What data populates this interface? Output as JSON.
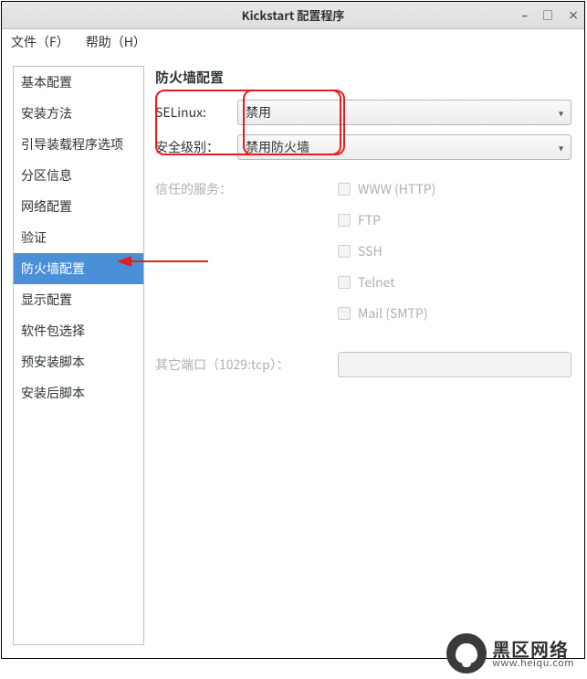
{
  "titlebar": {
    "title": "Kickstart 配置程序"
  },
  "menubar": {
    "file": "文件（F）",
    "help": "帮助（H）"
  },
  "sidebar": {
    "items": [
      "基本配置",
      "安装方法",
      "引导装载程序选项",
      "分区信息",
      "网络配置",
      "验证",
      "防火墙配置",
      "显示配置",
      "软件包选择",
      "预安装脚本",
      "安装后脚本"
    ],
    "selected_index": 6
  },
  "panel": {
    "title": "防火墙配置",
    "selinux_label": "SELinux:",
    "selinux_value": "禁用",
    "seclevel_label": "安全级别：",
    "seclevel_value": "禁用防火墙",
    "trusted_label": "信任的服务：",
    "services": [
      "WWW (HTTP)",
      "FTP",
      "SSH",
      "Telnet",
      "Mail (SMTP)"
    ],
    "other_ports_label": "其它端口（1029:tcp）："
  },
  "watermark": {
    "cn": "黑区网络",
    "en": "www.heiqu.com"
  }
}
